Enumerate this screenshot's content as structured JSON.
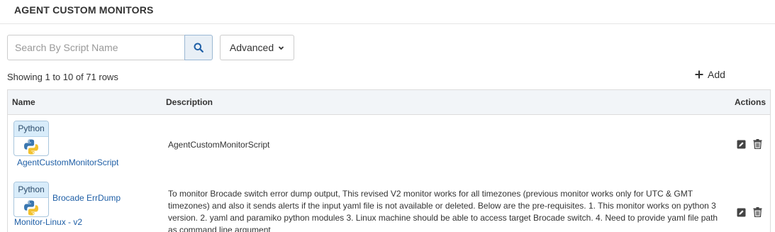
{
  "page": {
    "title": "AGENT CUSTOM MONITORS"
  },
  "search": {
    "placeholder": "Search By Script Name",
    "value": ""
  },
  "toolbar": {
    "advanced_label": "Advanced",
    "add_label": "Add"
  },
  "status": {
    "showing_text": "Showing 1 to 10 of 71 rows"
  },
  "table": {
    "columns": {
      "name": "Name",
      "description": "Description",
      "actions": "Actions"
    },
    "rows": [
      {
        "badge_label": "Python",
        "name": "AgentCustomMonitorScript",
        "name_line1": "",
        "description": "AgentCustomMonitorScript"
      },
      {
        "badge_label": "Python",
        "name_line1": "Brocade ErrDump",
        "name_line2": "Monitor-Linux - v2",
        "description": "To monitor Brocade switch error dump output, This revised V2 monitor works for all timezones (previous monitor works only for UTC & GMT timezones) and also it sends alerts if the input yaml file is not available or deleted. Below are the pre-requisites. 1. This monitor works on python 3 version. 2. yaml and paramiko python modules 3. Linux machine should be able to access target Brocade switch. 4. Need to provide yaml file path as command line argument"
      }
    ]
  },
  "icons": {
    "search": "search-icon",
    "chevron": "chevron-down-icon",
    "add": "plus-icon",
    "edit": "edit-icon",
    "delete": "trash-icon",
    "python": "python-logo-icon"
  },
  "colors": {
    "link": "#1f5fa6",
    "header_bg": "#f2f5f8",
    "search_btn_bg": "#e8eff6"
  }
}
